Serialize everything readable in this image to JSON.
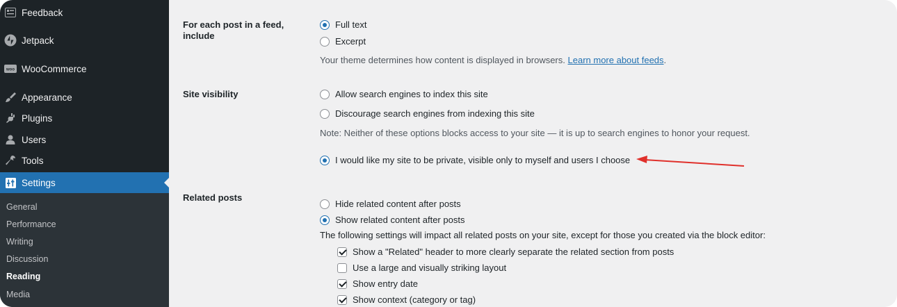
{
  "sidebar": {
    "menu": [
      {
        "label": "Feedback",
        "icon": "feedback-icon"
      },
      {
        "label": "Jetpack",
        "icon": "jetpack-icon"
      },
      {
        "label": "WooCommerce",
        "icon": "woocommerce-icon"
      },
      {
        "label": "Appearance",
        "icon": "appearance-icon"
      },
      {
        "label": "Plugins",
        "icon": "plugins-icon"
      },
      {
        "label": "Users",
        "icon": "users-icon"
      },
      {
        "label": "Tools",
        "icon": "tools-icon"
      },
      {
        "label": "Settings",
        "icon": "settings-icon"
      }
    ],
    "submenu": [
      "General",
      "Performance",
      "Writing",
      "Discussion",
      "Reading",
      "Media"
    ],
    "active_color": "#2271b1"
  },
  "feed": {
    "label": "For each post in a feed, include",
    "full_text": "Full text",
    "excerpt": "Excerpt",
    "note": "Your theme determines how content is displayed in browsers.",
    "link": "Learn more about feeds",
    "period": "."
  },
  "visibility": {
    "label": "Site visibility",
    "allow": "Allow search engines to index this site",
    "discourage": "Discourage search engines from indexing this site",
    "note": "Note: Neither of these options blocks access to your site — it is up to search engines to honor your request.",
    "private": "I would like my site to be private, visible only to myself and users I choose"
  },
  "related": {
    "label": "Related posts",
    "hide": "Hide related content after posts",
    "show": "Show related content after posts",
    "note": "The following settings will impact all related posts on your site, except for those you created via the block editor:",
    "header": "Show a \"Related\" header to more clearly separate the related section from posts",
    "layout": "Use a large and visually striking layout",
    "date": "Show entry date",
    "context": "Show context (category or tag)"
  },
  "annotation_color": "#e0302b"
}
